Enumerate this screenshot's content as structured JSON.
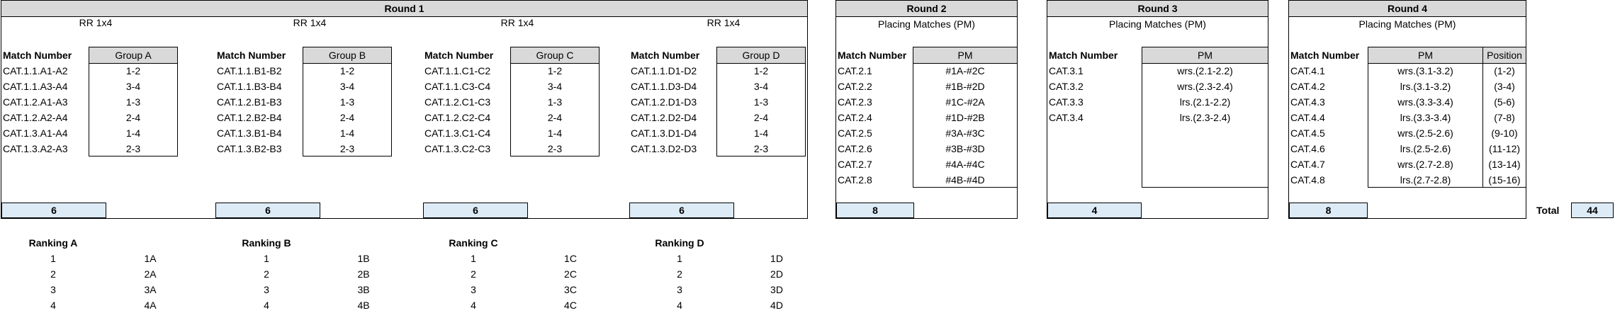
{
  "match_number_label": "Match Number",
  "round1": {
    "title": "Round 1",
    "groups": [
      {
        "format": "RR 1x4",
        "header": "Group A",
        "count": "6",
        "matches": [
          "CAT.1.1.A1-A2",
          "CAT.1.1.A3-A4",
          "CAT.1.2.A1-A3",
          "CAT.1.2.A2-A4",
          "CAT.1.3.A1-A4",
          "CAT.1.3.A2-A3"
        ],
        "values": [
          "1-2",
          "3-4",
          "1-3",
          "2-4",
          "1-4",
          "2-3"
        ]
      },
      {
        "format": "RR 1x4",
        "header": "Group B",
        "count": "6",
        "matches": [
          "CAT.1.1.B1-B2",
          "CAT.1.1.B3-B4",
          "CAT.1.2.B1-B3",
          "CAT.1.2.B2-B4",
          "CAT.1.3.B1-B4",
          "CAT.1.3.B2-B3"
        ],
        "values": [
          "1-2",
          "3-4",
          "1-3",
          "2-4",
          "1-4",
          "2-3"
        ]
      },
      {
        "format": "RR 1x4",
        "header": "Group C",
        "count": "6",
        "matches": [
          "CAT.1.1.C1-C2",
          "CAT.1.1.C3-C4",
          "CAT.1.2.C1-C3",
          "CAT.1.2.C2-C4",
          "CAT.1.3.C1-C4",
          "CAT.1.3.C2-C3"
        ],
        "values": [
          "1-2",
          "3-4",
          "1-3",
          "2-4",
          "1-4",
          "2-3"
        ]
      },
      {
        "format": "RR 1x4",
        "header": "Group D",
        "count": "6",
        "matches": [
          "CAT.1.1.D1-D2",
          "CAT.1.1.D3-D4",
          "CAT.1.2.D1-D3",
          "CAT.1.2.D2-D4",
          "CAT.1.3.D1-D4",
          "CAT.1.3.D2-D3"
        ],
        "values": [
          "1-2",
          "3-4",
          "1-3",
          "2-4",
          "1-4",
          "2-3"
        ]
      }
    ]
  },
  "round2": {
    "title": "Round 2",
    "subtitle": "Placing Matches (PM)",
    "pm_header": "PM",
    "count": "8",
    "matches": [
      "CAT.2.1",
      "CAT.2.2",
      "CAT.2.3",
      "CAT.2.4",
      "CAT.2.5",
      "CAT.2.6",
      "CAT.2.7",
      "CAT.2.8"
    ],
    "pm": [
      "#1A-#2C",
      "#1B-#2D",
      "#1C-#2A",
      "#1D-#2B",
      "#3A-#3C",
      "#3B-#3D",
      "#4A-#4C",
      "#4B-#4D"
    ]
  },
  "round3": {
    "title": "Round 3",
    "subtitle": "Placing Matches (PM)",
    "pm_header": "PM",
    "count": "4",
    "matches": [
      "CAT.3.1",
      "CAT.3.2",
      "CAT.3.3",
      "CAT.3.4"
    ],
    "pm": [
      "wrs.(2.1-2.2)",
      "wrs.(2.3-2.4)",
      "lrs.(2.1-2.2)",
      "lrs.(2.3-2.4)"
    ]
  },
  "round4": {
    "title": "Round 4",
    "subtitle": "Placing Matches (PM)",
    "pm_header": "PM",
    "position_header": "Position",
    "count": "8",
    "matches": [
      "CAT.4.1",
      "CAT.4.2",
      "CAT.4.3",
      "CAT.4.4",
      "CAT.4.5",
      "CAT.4.6",
      "CAT.4.7",
      "CAT.4.8"
    ],
    "pm": [
      "wrs.(3.1-3.2)",
      "lrs.(3.1-3.2)",
      "wrs.(3.3-3.4)",
      "lrs.(3.3-3.4)",
      "wrs.(2.5-2.6)",
      "lrs.(2.5-2.6)",
      "wrs.(2.7-2.8)",
      "lrs.(2.7-2.8)"
    ],
    "positions": [
      "(1-2)",
      "(3-4)",
      "(5-6)",
      "(7-8)",
      "(9-10)",
      "(11-12)",
      "(13-14)",
      "(15-16)"
    ]
  },
  "total": {
    "label": "Total",
    "value": "44"
  },
  "rankings": [
    {
      "title": "Ranking A",
      "ranks": [
        "1",
        "2",
        "3",
        "4"
      ],
      "labels": [
        "1A",
        "2A",
        "3A",
        "4A"
      ]
    },
    {
      "title": "Ranking B",
      "ranks": [
        "1",
        "2",
        "3",
        "4"
      ],
      "labels": [
        "1B",
        "2B",
        "3B",
        "4B"
      ]
    },
    {
      "title": "Ranking C",
      "ranks": [
        "1",
        "2",
        "3",
        "4"
      ],
      "labels": [
        "1C",
        "2C",
        "3C",
        "4C"
      ]
    },
    {
      "title": "Ranking D",
      "ranks": [
        "1",
        "2",
        "3",
        "4"
      ],
      "labels": [
        "1D",
        "2D",
        "3D",
        "4D"
      ]
    }
  ]
}
